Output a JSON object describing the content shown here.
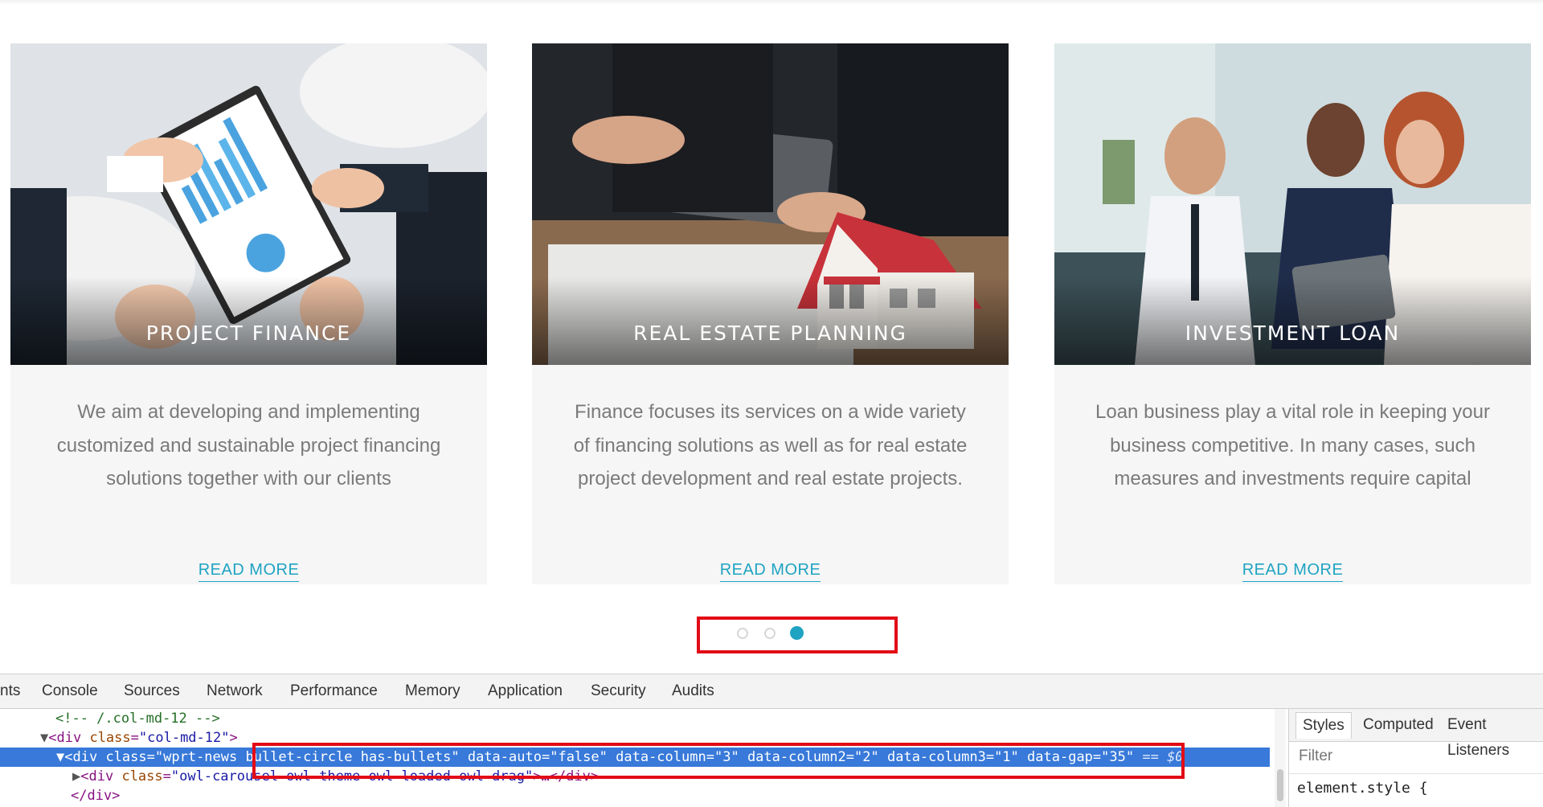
{
  "cards": [
    {
      "title": "PROJECT FINANCE",
      "description": "We aim at developing and implementing customized and sustainable project financing solutions together with our clients",
      "link": "READ MORE"
    },
    {
      "title": "REAL ESTATE PLANNING",
      "description": "Finance focuses its services on a wide variety of financing solutions as well as for real estate project development and real estate projects.",
      "link": "READ MORE"
    },
    {
      "title": "INVESTMENT LOAN",
      "description": "Loan business play a vital role in keeping your business competitive. In many cases, such measures and investments require capital",
      "link": "READ MORE"
    }
  ],
  "pager": {
    "count": 3,
    "active_index": 3
  },
  "colors": {
    "accent": "#1fa3c2",
    "highlight_box": "#e20b16",
    "selection": "#3879d9"
  },
  "devtools": {
    "tabs": [
      "nts",
      "Console",
      "Sources",
      "Network",
      "Performance",
      "Memory",
      "Application",
      "Security",
      "Audits"
    ],
    "lines": {
      "comment": "<!-- /.col-md-12 -->",
      "div_open": "<div",
      "class_attr": "class",
      "col_val": "\"col-md-12\"",
      "close": ">",
      "sel_tag": "<div",
      "sel_class_val_a": "\"wprt-news ",
      "sel_class_val_b": "bullet-circle has-bullets\"",
      "a1": "data-auto",
      "v1": "\"false\"",
      "a2": "data-column",
      "v2": "\"3\"",
      "a3": "data-column2",
      "v3": "\"2\"",
      "a4": "data-column3",
      "v4": "\"1\"",
      "a5": "data-gap",
      "v5": "\"35\"",
      "sel_tail": " == $0",
      "child_open": "<div",
      "owl_val": "\"owl-carousel owl-theme owl-loaded owl-drag\"",
      "child_tail": ">…</div>",
      "div_close": "</div>"
    },
    "styles_tabs": [
      "Styles",
      "Computed",
      "Event Listeners"
    ],
    "filter_placeholder": "Filter",
    "rule": "element.style {"
  }
}
